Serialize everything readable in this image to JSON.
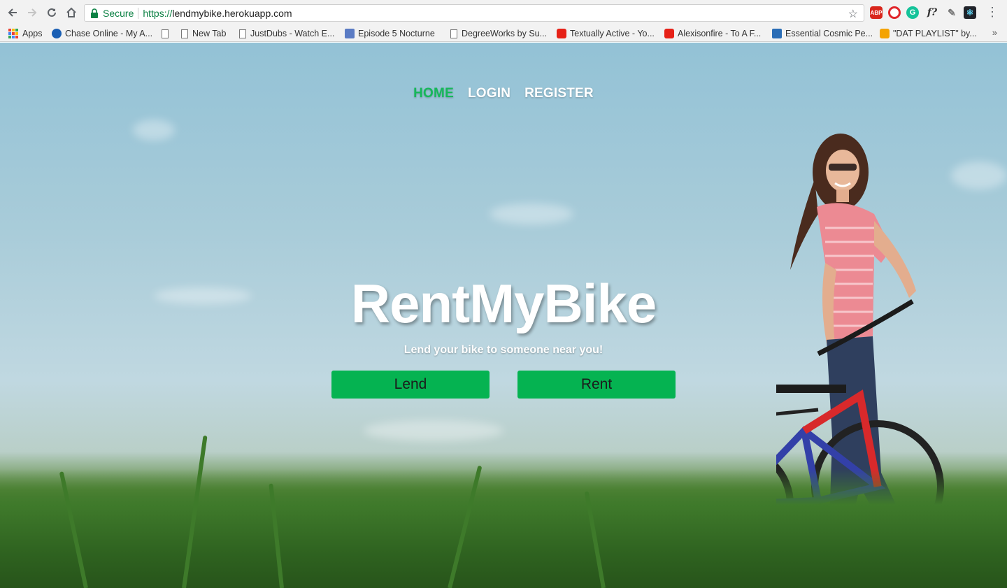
{
  "browser": {
    "secure_label": "Secure",
    "url_protocol": "https://",
    "url_host": "lendmybike.herokuapp.com",
    "extensions": [
      {
        "name": "adblock-plus",
        "text": "ABP"
      },
      {
        "name": "opera",
        "text": ""
      },
      {
        "name": "grammarly",
        "text": "G"
      },
      {
        "name": "font-finder",
        "text": "f?"
      },
      {
        "name": "eyedropper",
        "text": "✎"
      },
      {
        "name": "react-devtools",
        "text": "⚛"
      }
    ]
  },
  "bookmarks": {
    "apps": "Apps",
    "items": [
      {
        "label": "Chase Online - My A...",
        "icon": "chase-icon"
      },
      {
        "label": "",
        "icon": "doc-icon"
      },
      {
        "label": "New Tab",
        "icon": "doc-icon"
      },
      {
        "label": "JustDubs - Watch E...",
        "icon": "doc-icon"
      },
      {
        "label": "Episode 5 Nocturne",
        "icon": "episode-icon"
      },
      {
        "label": "DegreeWorks by Su...",
        "icon": "doc-icon"
      },
      {
        "label": "Textually Active - Yo...",
        "icon": "youtube-icon"
      },
      {
        "label": "Alexisonfire - To A F...",
        "icon": "youtube-icon"
      },
      {
        "label": "Essential Cosmic Pe...",
        "icon": "essential-icon"
      },
      {
        "label": "\"DAT PLAYLIST\" by...",
        "icon": "playlist-icon"
      }
    ],
    "more": "»"
  },
  "nav": {
    "home": "HOME",
    "login": "LOGIN",
    "register": "REGISTER"
  },
  "hero": {
    "title": "RentMyBike",
    "subtitle": "Lend your bike to someone near you!",
    "lend_label": "Lend",
    "rent_label": "Rent"
  },
  "colors": {
    "accent": "#05b351",
    "nav_active": "#16b85a",
    "secure_green": "#0b8043"
  }
}
